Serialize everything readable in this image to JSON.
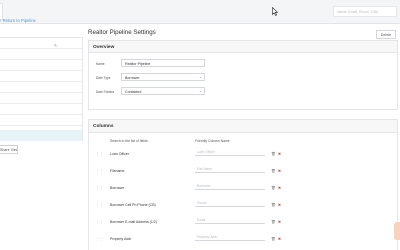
{
  "header": {
    "global_search_placeholder": "Name, Email, Phone, DBA"
  },
  "nav": {
    "back_link": "Return to Pipeline"
  },
  "sidebar": {
    "share_view_label": "Share View"
  },
  "page": {
    "title": "Realtor Pipeline Settings",
    "delete_label": "Delete"
  },
  "overview": {
    "heading": "Overview",
    "name_label": "Name",
    "name_value": "Realtor Pipeline",
    "date_type_label": "Date Type",
    "date_type_value": "Borrower",
    "date_folders_label": "Date Folders",
    "date_folders_value": "Contacted"
  },
  "columns": {
    "heading": "Columns",
    "search_header": "Search in the list of fields",
    "friendly_header": "Friendly Column Name",
    "rows": [
      {
        "field": "Loan Officer",
        "placeholder": "Loan Officer"
      },
      {
        "field": "Filename",
        "placeholder": "File Name"
      },
      {
        "field": "Borrower",
        "placeholder": "Borrower"
      },
      {
        "field": "Borrower Cell Ph Phone (CB)",
        "placeholder": "Phone"
      },
      {
        "field": "Borrower E-mail Address (1/2)",
        "placeholder": "Email"
      },
      {
        "field": "Property Addr",
        "placeholder": "Property Addr"
      }
    ]
  },
  "colors": {
    "link": "#5b95c9",
    "selected_row": "#e8f3f7",
    "remove_icon": "#c0392b",
    "help_tab": "#f7d3bd"
  }
}
